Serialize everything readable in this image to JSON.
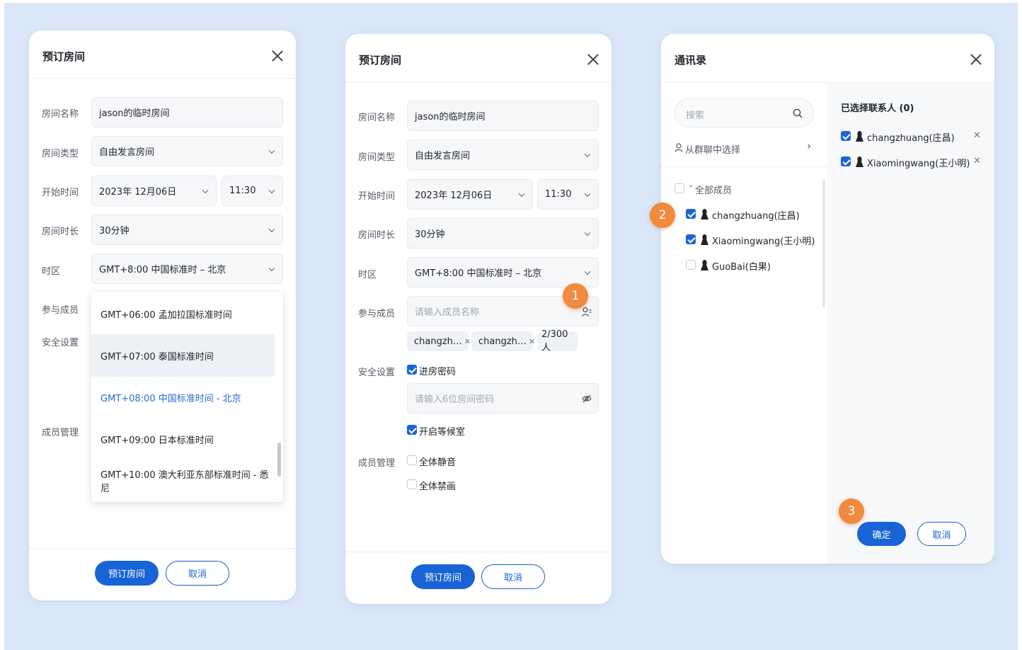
{
  "panel1": {
    "title": "预订房间",
    "labels": {
      "room_name": "房间名称",
      "room_type": "房间类型",
      "start_time": "开始时间",
      "duration": "房间时长",
      "timezone": "时区",
      "members": "参与成员",
      "security": "安全设置",
      "member_mgmt": "成员管理"
    },
    "room_name_value": "jason的临时房间",
    "room_type_value": "自由发言房间",
    "date_value": "2023年 12月06日",
    "time_value": "11:30",
    "duration_value": "30分钟",
    "timezone_value": "GMT+8:00 中国标准时 – 北京",
    "timezone_options": [
      "GMT+06:00 孟加拉国标准时间",
      "GMT+07:00 泰国标准时间",
      "GMT+08:00 中国标准时间 - 北京",
      "GMT+09:00 日本标准时间",
      "GMT+10:00 澳大利亚东部标准时间 - 悉尼"
    ],
    "hovered_option_index": 1,
    "selected_option_index": 2,
    "book_button": "预订房间",
    "cancel_button": "取消"
  },
  "panel2": {
    "title": "预订房间",
    "labels": {
      "room_name": "房间名称",
      "room_type": "房间类型",
      "start_time": "开始时间",
      "duration": "房间时长",
      "timezone": "时区",
      "members": "参与成员",
      "security": "安全设置",
      "member_mgmt": "成员管理"
    },
    "room_name_value": "jason的临时房间",
    "room_type_value": "自由发言房间",
    "date_value": "2023年 12月06日",
    "time_value": "11:30",
    "duration_value": "30分钟",
    "timezone_value": "GMT+8:00 中国标准时 – 北京",
    "members_placeholder": "请输入成员名称",
    "member_tags": [
      "changzh…",
      "changzh…"
    ],
    "member_count": "2/300 人",
    "room_password_label": "进房密码",
    "room_password_checked": true,
    "password_placeholder": "请输入6位房间密码",
    "waiting_room_label": "开启等候室",
    "waiting_room_checked": true,
    "mute_all_label": "全体静音",
    "mute_all_checked": false,
    "ban_video_label": "全体禁画",
    "ban_video_checked": false,
    "book_button": "预订房间",
    "cancel_button": "取消"
  },
  "panel3": {
    "title": "通讯录",
    "search_placeholder": "搜索",
    "group_select_label": "从群聊中选择",
    "all_members_label": "全部成员",
    "contacts": [
      {
        "name": "changzhuang(庄昌)",
        "checked": true
      },
      {
        "name": "Xiaomingwang(王小明)",
        "checked": true
      },
      {
        "name": "GuoBai(白果)",
        "checked": false
      }
    ],
    "selected_header": "已选择联系人 (0)",
    "selected": [
      "changzhuang(庄昌)",
      "Xiaomingwang(王小明)"
    ],
    "confirm_button": "确定",
    "cancel_button": "取消"
  },
  "badges": [
    "1",
    "2",
    "3"
  ],
  "colors": {
    "primary": "#1863d6",
    "badge": "#f08a3c",
    "background": "#d9e7f8"
  }
}
